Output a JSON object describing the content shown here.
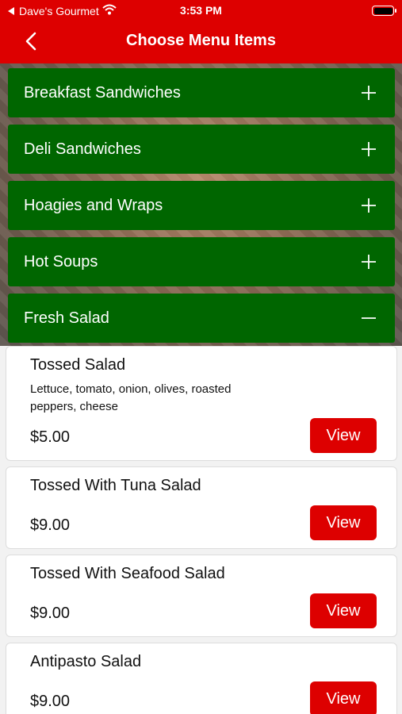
{
  "status_bar": {
    "carrier": "Dave's Gourmet",
    "time": "3:53 PM",
    "icons": [
      "back-to-app-icon",
      "wifi-icon",
      "battery-icon"
    ]
  },
  "header": {
    "title": "Choose Menu Items",
    "back_icon": "chevron-left-icon"
  },
  "categories": [
    {
      "label": "Breakfast Sandwiches",
      "icon": "plus-icon"
    },
    {
      "label": "Deli Sandwiches",
      "icon": "plus-icon"
    },
    {
      "label": "Hoagies and Wraps",
      "icon": "plus-icon"
    },
    {
      "label": "Hot Soups",
      "icon": "plus-icon"
    },
    {
      "label": "Fresh Salad",
      "icon": "minus-icon"
    }
  ],
  "items": [
    {
      "name": "Tossed Salad",
      "description": "Lettuce, tomato, onion, olives, roasted peppers, cheese",
      "price": "$5.00",
      "button": "View"
    },
    {
      "name": "Tossed With Tuna Salad",
      "price": "$9.00",
      "button": "View"
    },
    {
      "name": "Tossed With Seafood Salad",
      "price": "$9.00",
      "button": "View"
    },
    {
      "name": "Antipasto Salad",
      "price": "$9.00",
      "button": "View"
    }
  ],
  "colors": {
    "header": "#dd0000",
    "category": "#006600",
    "button": "#dd0000"
  }
}
